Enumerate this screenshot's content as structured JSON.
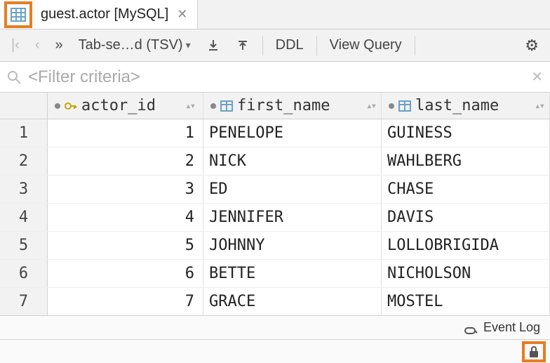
{
  "tab": {
    "title": "guest.actor [MySQL]"
  },
  "toolbar": {
    "format_label": "Tab-se…d (TSV)",
    "ddl_label": "DDL",
    "view_query_label": "View Query"
  },
  "filter": {
    "placeholder": "<Filter criteria>"
  },
  "columns": {
    "actor_id": "actor_id",
    "first_name": "first_name",
    "last_name": "last_name"
  },
  "rows": [
    {
      "n": "1",
      "actor_id": "1",
      "first_name": "PENELOPE",
      "last_name": "GUINESS"
    },
    {
      "n": "2",
      "actor_id": "2",
      "first_name": "NICK",
      "last_name": "WAHLBERG"
    },
    {
      "n": "3",
      "actor_id": "3",
      "first_name": "ED",
      "last_name": "CHASE"
    },
    {
      "n": "4",
      "actor_id": "4",
      "first_name": "JENNIFER",
      "last_name": "DAVIS"
    },
    {
      "n": "5",
      "actor_id": "5",
      "first_name": "JOHNNY",
      "last_name": "LOLLOBRIGIDA"
    },
    {
      "n": "6",
      "actor_id": "6",
      "first_name": "BETTE",
      "last_name": "NICHOLSON"
    },
    {
      "n": "7",
      "actor_id": "7",
      "first_name": "GRACE",
      "last_name": "MOSTEL"
    }
  ],
  "status": {
    "event_log": "Event Log"
  }
}
